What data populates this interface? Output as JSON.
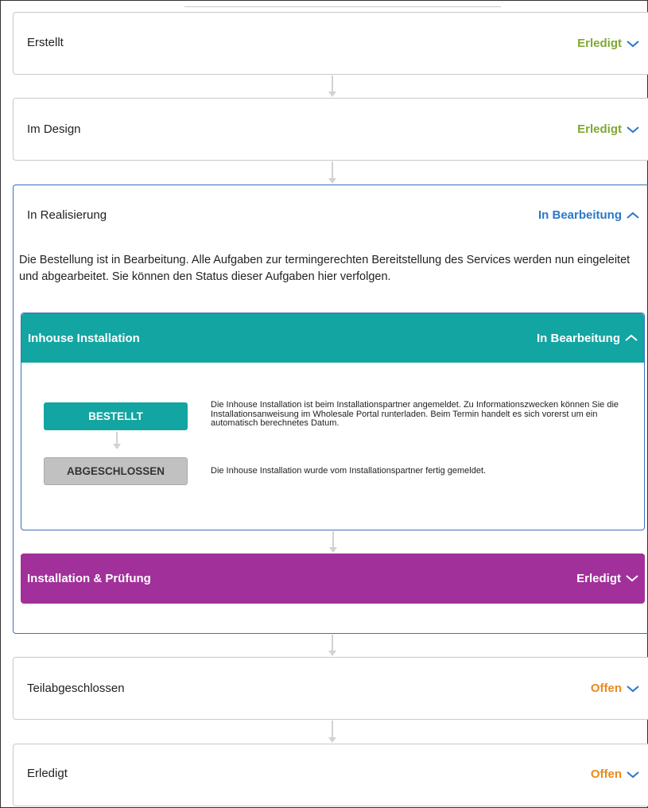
{
  "steps": {
    "created": {
      "label": "Erstellt",
      "status": "Erledigt"
    },
    "design": {
      "label": "Im Design",
      "status": "Erledigt"
    },
    "realization": {
      "label": "In Realisierung",
      "status": "In Bearbeitung",
      "description": "Die Bestellung ist in Bearbeitung. Alle Aufgaben zur termingerechten Bereitstellung des Services werden nun eingeleitet und abgearbeitet. Sie können den Status dieser Aufgaben hier verfolgen."
    },
    "partial": {
      "label": "Teilabgeschlossen",
      "status": "Offen"
    },
    "done": {
      "label": "Erledigt",
      "status": "Offen"
    }
  },
  "subtasks": {
    "inhouse": {
      "label": "Inhouse Installation",
      "status": "In Bearbeitung",
      "color": "#13a5a2",
      "stages": [
        {
          "label": "BESTELLT",
          "text": "Die Inhouse Installation ist beim Installationspartner angemeldet. Zu Informationszwecken können Sie die Installationsanweisung im Wholesale Portal runterladen. Beim Termin handelt es sich vorerst um ein automatisch berechnetes Datum."
        },
        {
          "label": "ABGESCHLOSSEN",
          "text": "Die Inhouse Installation wurde vom Installationspartner fertig gemeldet."
        }
      ]
    },
    "installation_test": {
      "label": "Installation & Prüfung",
      "status": "Erledigt",
      "color": "#a2309a"
    }
  },
  "colors": {
    "status_done": "#7fa832",
    "status_open": "#ea8a1c",
    "status_active": "#2a78c8",
    "active_border": "#3b6fbf"
  },
  "icons": {
    "collapsed": "chevron-down-icon",
    "expanded": "chevron-up-icon",
    "connector": "arrow-down-icon"
  }
}
